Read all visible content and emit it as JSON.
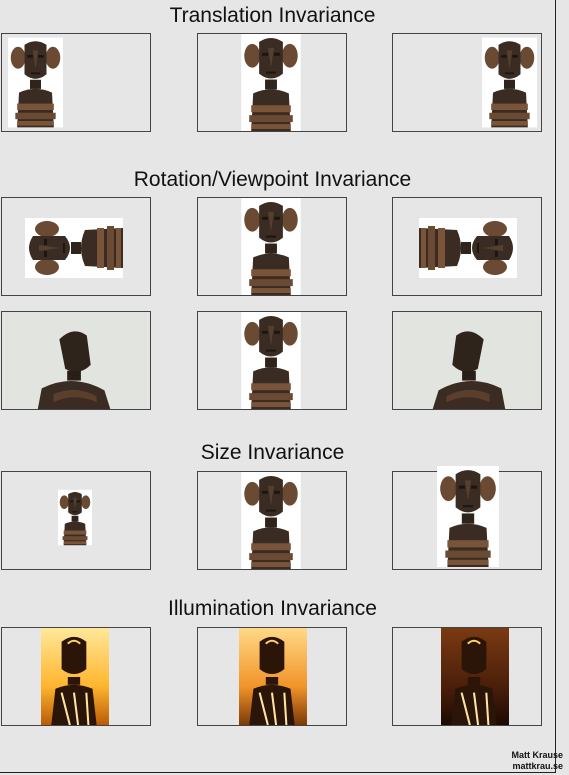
{
  "headings": {
    "translation": "Translation Invariance",
    "rotation": "Rotation/Viewpoint Invariance",
    "size": "Size Invariance",
    "illumination": "Illumination Invariance"
  },
  "credit": {
    "name": "Matt Krause",
    "site": "mattkrau.se"
  },
  "colors": {
    "background": "#e6e6e6",
    "frame_border": "#444444",
    "wood_dark": "#3a2c22",
    "wood_light": "#6b4a33",
    "warm_glow": "#ffc84a"
  },
  "rows": [
    {
      "heading_key": "translation",
      "photos": [
        "statue-front-left",
        "statue-front-center",
        "statue-front-right"
      ]
    },
    {
      "heading_key": "rotation",
      "photos": [
        "statue-rotated-left",
        "statue-front-center",
        "statue-rotated-right"
      ]
    },
    {
      "heading_key": "rotation",
      "photos": [
        "statue-side-view-left",
        "statue-front-center",
        "statue-side-view-right"
      ]
    },
    {
      "heading_key": "size",
      "photos": [
        "statue-small",
        "statue-medium",
        "statue-large"
      ]
    },
    {
      "heading_key": "illumination",
      "photos": [
        "statue-backlit-bright",
        "statue-backlit-warm",
        "statue-backlit-dark"
      ]
    }
  ]
}
